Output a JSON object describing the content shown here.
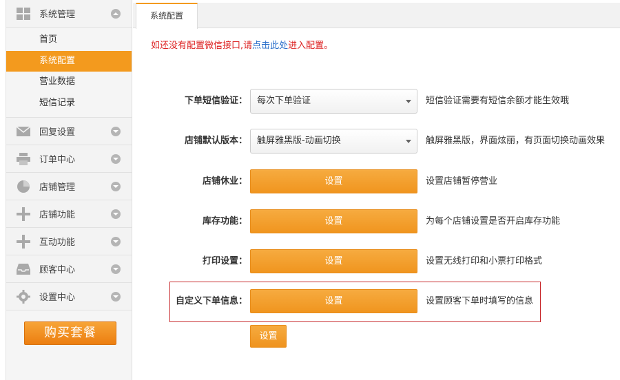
{
  "sidebar": {
    "system": {
      "label": "系统管理",
      "items": [
        {
          "label": "首页",
          "active": false
        },
        {
          "label": "系统配置",
          "active": true
        },
        {
          "label": "营业数据",
          "active": false
        },
        {
          "label": "短信记录",
          "active": false
        }
      ]
    },
    "sections": [
      {
        "label": "回复设置",
        "icon": "mail-icon"
      },
      {
        "label": "订单中心",
        "icon": "printer-icon"
      },
      {
        "label": "店铺管理",
        "icon": "pie-chart-icon"
      },
      {
        "label": "店铺功能",
        "icon": "plus-icon"
      },
      {
        "label": "互动功能",
        "icon": "plus-icon"
      },
      {
        "label": "顾客中心",
        "icon": "inbox-icon"
      },
      {
        "label": "设置中心",
        "icon": "gear-icon"
      }
    ],
    "buy_button": "购买套餐"
  },
  "tab": {
    "label": "系统配置"
  },
  "notice": {
    "before": "如还没有配置微信接口,请",
    "link": "点击此处",
    "after": "进入配置。"
  },
  "settings": [
    {
      "label": "下单短信验证：",
      "type": "select",
      "value": "每次下单验证",
      "desc": "短信验证需要有短信余额才能生效哦"
    },
    {
      "label": "店铺默认版本：",
      "type": "select",
      "value": "触屏雅黑版-动画切换",
      "desc": "触屏雅黑版，界面炫丽，有页面切换动画效果"
    },
    {
      "label": "店铺休业：",
      "type": "button",
      "value": "设置",
      "desc": "设置店铺暂停营业"
    },
    {
      "label": "库存功能：",
      "type": "button",
      "value": "设置",
      "desc": "为每个店铺设置是否开启库存功能"
    },
    {
      "label": "打印设置：",
      "type": "button",
      "value": "设置",
      "desc": "设置无线打印和小票打印格式"
    },
    {
      "label": "自定义下单信息：",
      "type": "button",
      "value": "设置",
      "desc": "设置顾客下单时填写的信息"
    }
  ],
  "extra_button": "设置",
  "colors": {
    "accent": "#f39a1e",
    "highlight_border": "#c8282b",
    "notice": "#dd2222",
    "link": "#2a6fcb"
  }
}
